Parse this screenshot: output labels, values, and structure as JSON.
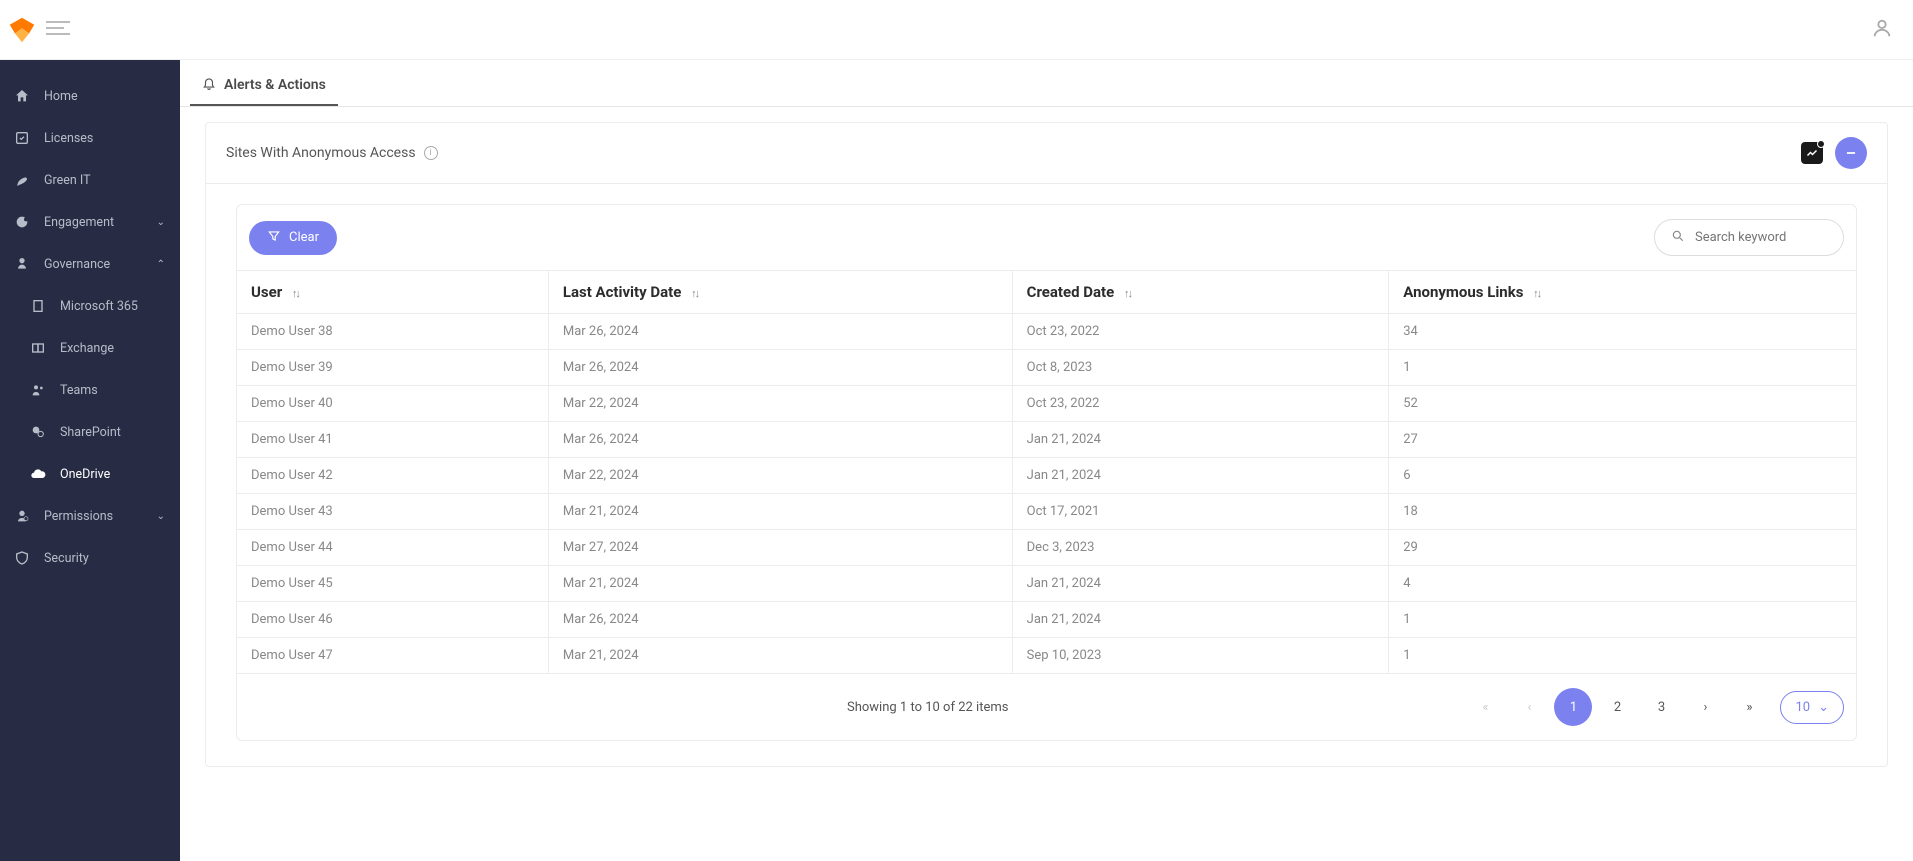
{
  "header": {
    "tab_label": "Alerts & Actions"
  },
  "sidebar": {
    "items": [
      {
        "label": "Home"
      },
      {
        "label": "Licenses"
      },
      {
        "label": "Green IT"
      },
      {
        "label": "Engagement"
      },
      {
        "label": "Governance"
      },
      {
        "label": "Microsoft 365"
      },
      {
        "label": "Exchange"
      },
      {
        "label": "Teams"
      },
      {
        "label": "SharePoint"
      },
      {
        "label": "OneDrive"
      },
      {
        "label": "Permissions"
      },
      {
        "label": "Security"
      }
    ]
  },
  "panel": {
    "title": "Sites With Anonymous Access"
  },
  "toolbar": {
    "clear_label": "Clear",
    "search_placeholder": "Search keyword"
  },
  "table": {
    "columns": {
      "user": "User",
      "last_activity": "Last Activity Date",
      "created": "Created Date",
      "anonymous": "Anonymous Links"
    },
    "rows": [
      {
        "user": "Demo User 38",
        "last_activity": "Mar 26, 2024",
        "created": "Oct 23, 2022",
        "anonymous": "34"
      },
      {
        "user": "Demo User 39",
        "last_activity": "Mar 26, 2024",
        "created": "Oct 8, 2023",
        "anonymous": "1"
      },
      {
        "user": "Demo User 40",
        "last_activity": "Mar 22, 2024",
        "created": "Oct 23, 2022",
        "anonymous": "52"
      },
      {
        "user": "Demo User 41",
        "last_activity": "Mar 26, 2024",
        "created": "Jan 21, 2024",
        "anonymous": "27"
      },
      {
        "user": "Demo User 42",
        "last_activity": "Mar 22, 2024",
        "created": "Jan 21, 2024",
        "anonymous": "6"
      },
      {
        "user": "Demo User 43",
        "last_activity": "Mar 21, 2024",
        "created": "Oct 17, 2021",
        "anonymous": "18"
      },
      {
        "user": "Demo User 44",
        "last_activity": "Mar 27, 2024",
        "created": "Dec 3, 2023",
        "anonymous": "29"
      },
      {
        "user": "Demo User 45",
        "last_activity": "Mar 21, 2024",
        "created": "Jan 21, 2024",
        "anonymous": "4"
      },
      {
        "user": "Demo User 46",
        "last_activity": "Mar 26, 2024",
        "created": "Jan 21, 2024",
        "anonymous": "1"
      },
      {
        "user": "Demo User 47",
        "last_activity": "Mar 21, 2024",
        "created": "Sep 10, 2023",
        "anonymous": "1"
      }
    ]
  },
  "pagination": {
    "summary": "Showing 1 to 10 of 22 items",
    "pages": [
      "1",
      "2",
      "3"
    ],
    "page_size": "10"
  }
}
